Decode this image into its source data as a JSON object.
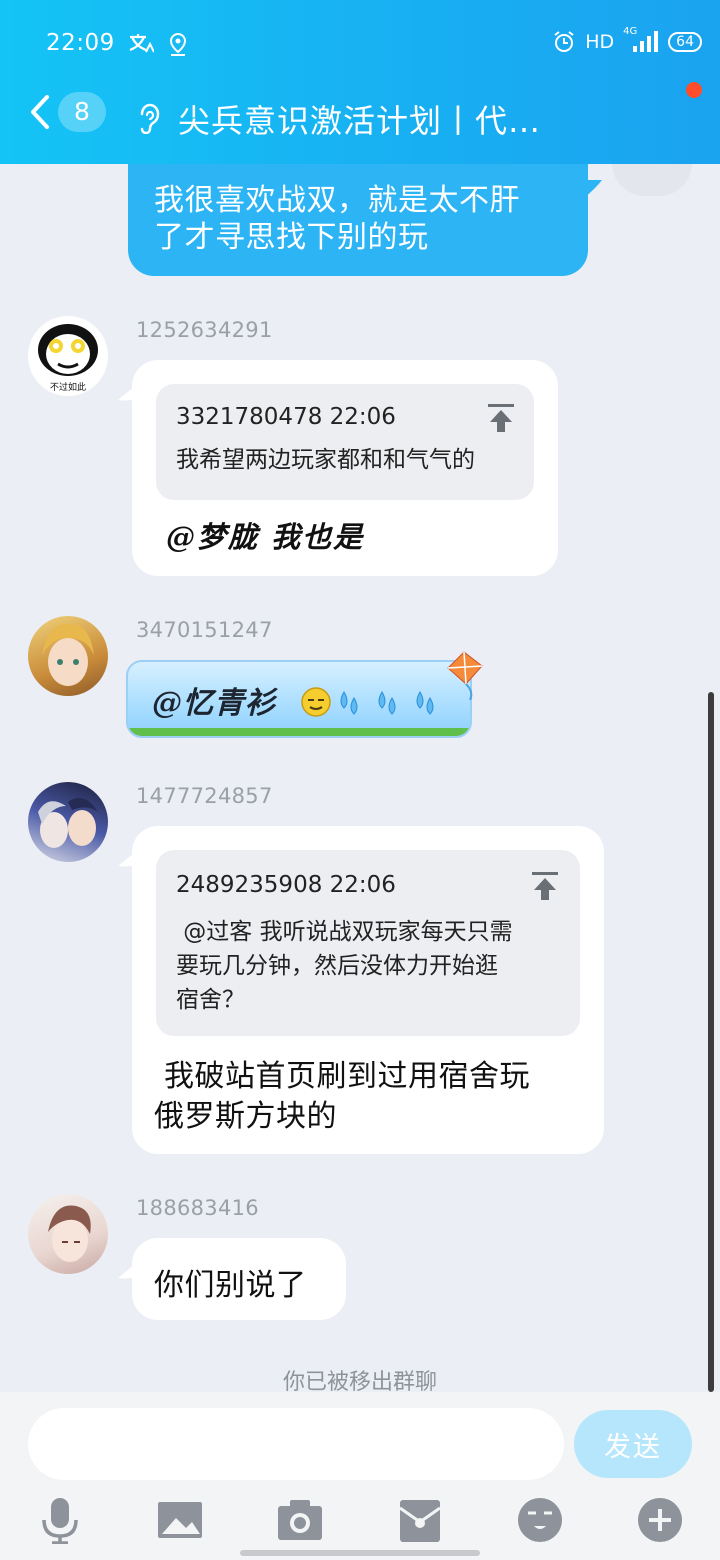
{
  "status_bar": {
    "time": "22:09",
    "network": "HD",
    "signal": "4G",
    "battery": "64"
  },
  "header": {
    "back_count": "8",
    "title": "尖兵意识激活计划丨代…"
  },
  "messages": {
    "self": {
      "text_line1": "我很喜欢战双，就是太不肝",
      "text_line2": "了才寻思找下别的玩"
    },
    "m1": {
      "uid": "1252634291",
      "avatar_caption": "不过如此",
      "quote_head": "3321780478 22:06",
      "quote_text": "我希望两边玩家都和和气气的",
      "reply": "@梦胧 我也是"
    },
    "m2": {
      "uid": "3470151247",
      "text": "@忆青衫"
    },
    "m3": {
      "uid": "1477724857",
      "quote_head": "2489235908 22:06",
      "quote_line1": " @过客 我听说战双玩家每天只需",
      "quote_line2": "要玩几分钟，然后没体力开始逛",
      "quote_line3": "宿舍？",
      "reply_line1": " 我破站首页刷到过用宿舍玩",
      "reply_line2": "俄罗斯方块的"
    },
    "m4": {
      "uid": "188683416",
      "text": "你们别说了"
    }
  },
  "system_notice": "你已被移出群聊",
  "input": {
    "placeholder": "",
    "send_label": "发送"
  },
  "toolbar": [
    "microphone-icon",
    "image-icon",
    "camera-icon",
    "red-packet-icon",
    "emoji-icon",
    "plus-icon"
  ],
  "colors": {
    "header": "#18b0f2",
    "self_bubble": "#2cb4f5",
    "send_button": "#b6e6fb",
    "background": "#ebeef4"
  }
}
